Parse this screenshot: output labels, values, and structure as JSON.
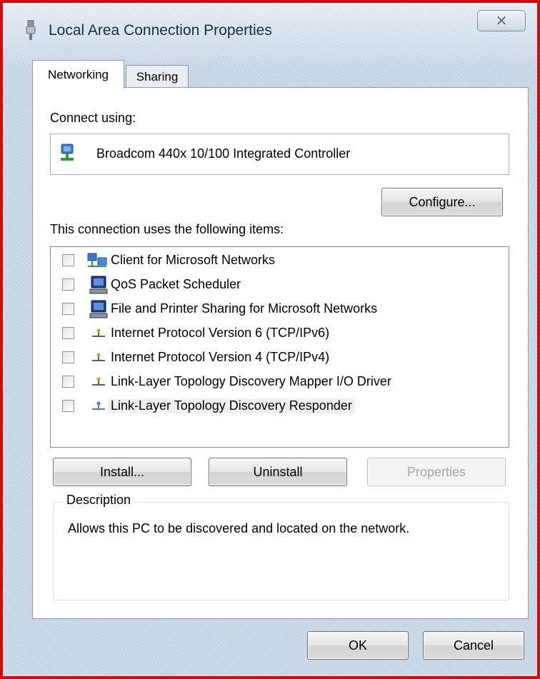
{
  "window": {
    "title": "Local Area Connection Properties",
    "close_symbol": "✕"
  },
  "tabs": [
    {
      "label": "Networking",
      "active": true
    },
    {
      "label": "Sharing",
      "active": false
    }
  ],
  "connect": {
    "label": "Connect using:",
    "adapter": "Broadcom 440x 10/100 Integrated Controller",
    "adapter_icon": "network-adapter-icon",
    "configure_label": "Configure..."
  },
  "items_section": {
    "label": "This connection uses the following items:",
    "items": [
      {
        "label": "Client for Microsoft Networks",
        "checked": false,
        "icon": "network-client-icon"
      },
      {
        "label": "QoS Packet Scheduler",
        "checked": false,
        "icon": "computer-service-icon"
      },
      {
        "label": "File and Printer Sharing for Microsoft Networks",
        "checked": false,
        "icon": "computer-service-icon"
      },
      {
        "label": "Internet Protocol Version 6 (TCP/IPv6)",
        "checked": false,
        "icon": "protocol-icon"
      },
      {
        "label": "Internet Protocol Version 4 (TCP/IPv4)",
        "checked": false,
        "icon": "protocol-icon"
      },
      {
        "label": "Link-Layer Topology Discovery Mapper I/O Driver",
        "checked": false,
        "icon": "protocol-icon"
      },
      {
        "label": "Link-Layer Topology Discovery Responder",
        "checked": false,
        "icon": "protocol-icon",
        "selected": true
      }
    ]
  },
  "actions": {
    "install_label": "Install...",
    "uninstall_label": "Uninstall",
    "properties_label": "Properties"
  },
  "description": {
    "title": "Description",
    "text": "Allows this PC to be discovered and located on the network."
  },
  "footer": {
    "ok_label": "OK",
    "cancel_label": "Cancel"
  },
  "colors": {
    "frame_border": "#d20a0a",
    "panel_bg": "#ffffff",
    "window_bg": "#c9d8e8"
  }
}
